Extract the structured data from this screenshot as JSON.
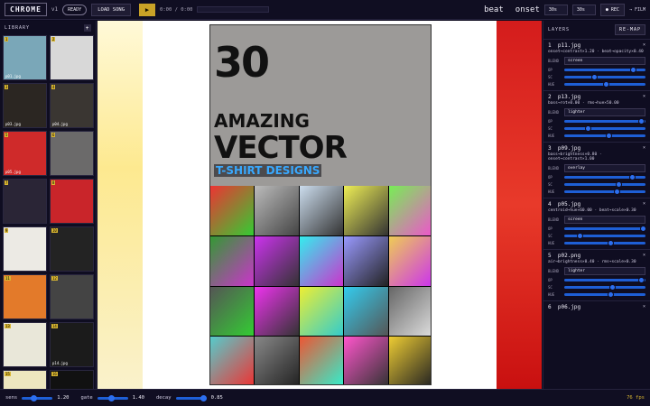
{
  "top": {
    "brand": "CHROME",
    "version": "v1",
    "status": "READY",
    "load_label": "LOAD SONG",
    "play_icon": "play-icon",
    "time": "0:00 / 0:00",
    "beat_label": "beat",
    "onset_label": "onset",
    "select1": "30s",
    "select2": "30s",
    "rec_label": "● REC",
    "film_label": "→ FILM"
  },
  "library": {
    "title": "LIBRARY",
    "add": "+",
    "items": [
      {
        "num": "1",
        "name": "p01.jpg",
        "color": "#7aa7b8"
      },
      {
        "num": "2",
        "name": "",
        "color": "#d8d8d8"
      },
      {
        "num": "3",
        "name": "p03.jpg",
        "color": "#2b2622"
      },
      {
        "num": "4",
        "name": "p04.jpg",
        "color": "#3a3632"
      },
      {
        "num": "5",
        "name": "p05.jpg",
        "color": "#cf2a2a"
      },
      {
        "num": "6",
        "name": "",
        "color": "#6b6a6a"
      },
      {
        "num": "7",
        "name": "",
        "color": "#2a2536"
      },
      {
        "num": "8",
        "name": "",
        "color": "#c9252a"
      },
      {
        "num": "9",
        "name": "",
        "color": "#eceae4"
      },
      {
        "num": "10",
        "name": "",
        "color": "#232323"
      },
      {
        "num": "11",
        "name": "",
        "color": "#e37a2a"
      },
      {
        "num": "12",
        "name": "",
        "color": "#444444"
      },
      {
        "num": "13",
        "name": "",
        "color": "#e9e7d9"
      },
      {
        "num": "14",
        "name": "p14.jpg",
        "color": "#1b1b1b"
      },
      {
        "num": "15",
        "name": "",
        "color": "#ede6bf"
      },
      {
        "num": "16",
        "name": "",
        "color": "#111111"
      }
    ]
  },
  "poster": {
    "line1": "30",
    "line2": "AMAZING",
    "line3": "VECTOR",
    "line4": "T-SHIRT DESIGNS"
  },
  "layers": {
    "title": "LAYERS",
    "remap": "RE-MAP",
    "items": [
      {
        "num": "1",
        "name": "p11.jpg",
        "mod": "onset→contrast×1.20 · beat→opacity×0.40",
        "blend": "screen",
        "op": 0.86,
        "sc": 0.38,
        "hue": 0.52
      },
      {
        "num": "2",
        "name": "p13.jpg",
        "mod": "bass→rot×0.00 · rms→hue×50.00",
        "blend": "lighter",
        "op": 0.95,
        "sc": 0.3,
        "hue": 0.55
      },
      {
        "num": "3",
        "name": "p09.jpg",
        "mod": "bass→brightness×0.80 · onset→contrast×1.00",
        "blend": "overlay",
        "op": 0.84,
        "sc": 0.68,
        "hue": 0.66
      },
      {
        "num": "4",
        "name": "p05.jpg",
        "mod": "centroid→hue×60.00 · beat→scale×0.30",
        "blend": "screen",
        "op": 0.98,
        "sc": 0.2,
        "hue": 0.58
      },
      {
        "num": "5",
        "name": "p02.png",
        "mod": "air→brightness×0.40 · rms→scale×0.30",
        "blend": "lighter",
        "op": 0.95,
        "sc": 0.6,
        "hue": 0.58
      },
      {
        "num": "6",
        "name": "p06.jpg",
        "mod": "",
        "blend": "",
        "op": 0.5,
        "sc": 0.5,
        "hue": 0.5
      }
    ],
    "blend_label": "BLEND",
    "op_label": "OP",
    "sc_label": "SC",
    "hue_label": "HUE"
  },
  "bottom": {
    "sens_label": "sens",
    "sens_val": "1.20",
    "gate_label": "gate",
    "gate_val": "1.40",
    "decay_label": "decay",
    "decay_val": "0.85",
    "fps": "76 fps"
  }
}
